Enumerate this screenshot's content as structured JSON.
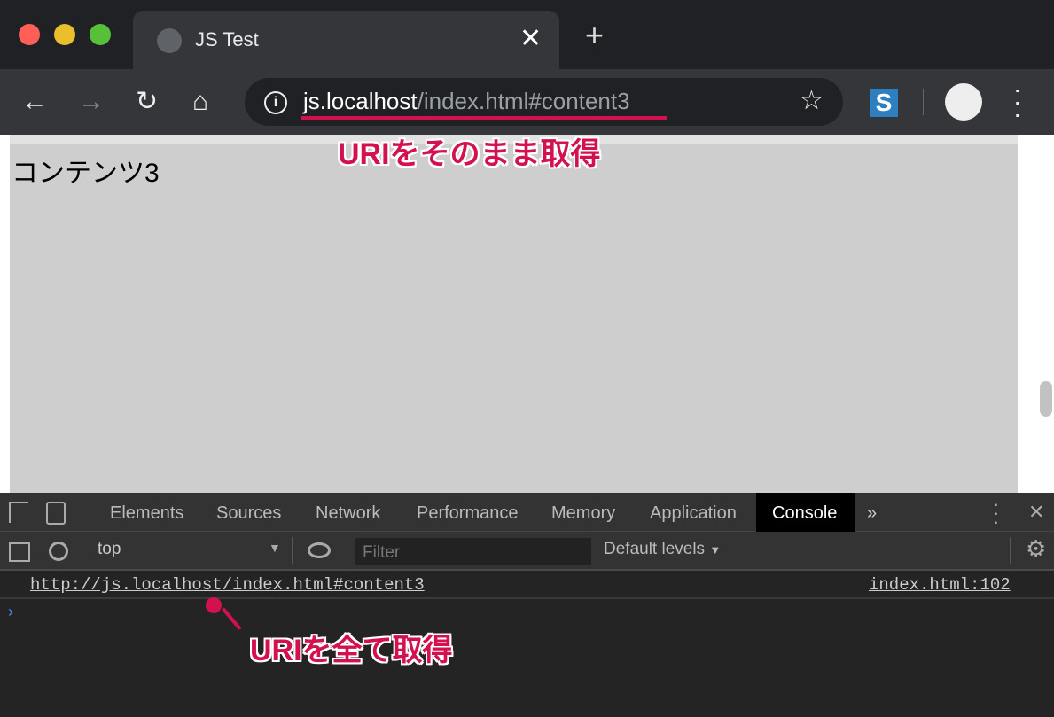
{
  "window": {
    "controls": {
      "close_color": "#ff5f57",
      "minimize_color": "#ebbf2b",
      "zoom_color": "#57c038"
    }
  },
  "tab": {
    "title": "JS Test",
    "icon": "globe-icon"
  },
  "toolbar": {
    "url_host": "js.localhost",
    "url_path": "/index.html#content3"
  },
  "page": {
    "content_text": "コンテンツ3"
  },
  "annotations": {
    "top": "URIをそのまま取得",
    "bottom": "URIを全て取得",
    "color": "#d4114f"
  },
  "devtools": {
    "tabs": [
      "Elements",
      "Sources",
      "Network",
      "Performance",
      "Memory",
      "Application",
      "Console"
    ],
    "active_tab": "Console",
    "context": "top",
    "filter_placeholder": "Filter",
    "levels": "Default levels",
    "log": {
      "message": "http://js.localhost/index.html#content3",
      "source": "index.html:102"
    }
  }
}
